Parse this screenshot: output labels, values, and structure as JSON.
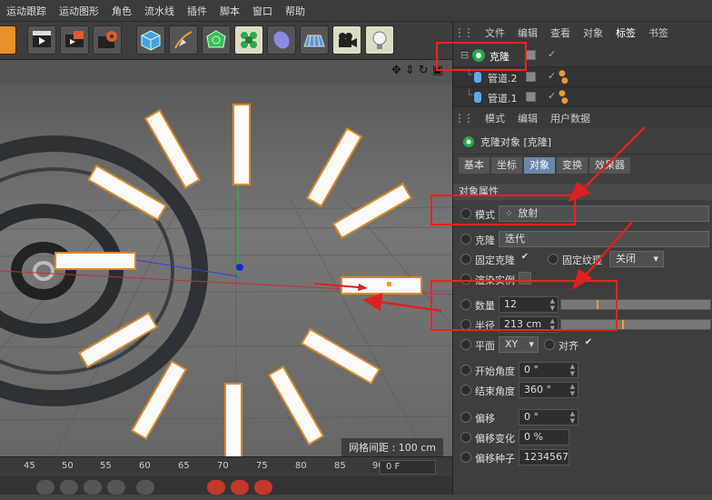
{
  "menubar": {
    "items": [
      "运动跟踪",
      "运动图形",
      "角色",
      "流水线",
      "插件",
      "脚本",
      "窗口",
      "帮助"
    ]
  },
  "toolbar": {
    "buttons": [
      "cube-icon",
      "pen-icon",
      "subdivision-icon",
      "cloner-icon",
      "deformer-icon",
      "floor-icon",
      "camera-icon",
      "light-icon"
    ]
  },
  "viewport": {
    "grid_spacing": "网格间距 : 100 cm"
  },
  "timeline": {
    "ticks": [
      "45",
      "50",
      "55",
      "60",
      "65",
      "70",
      "75",
      "80",
      "85",
      "90"
    ],
    "current_frame": "0 F"
  },
  "object_manager": {
    "menu": [
      "文件",
      "编辑",
      "查看",
      "对象",
      "标签",
      "书签"
    ],
    "active_menu_index": 4,
    "objects": [
      {
        "name": "克隆",
        "type": "cloner"
      },
      {
        "name": "管道.2",
        "type": "tube"
      },
      {
        "name": "管道.1",
        "type": "tube"
      }
    ]
  },
  "attribute_manager": {
    "menu": [
      "模式",
      "编辑",
      "用户数据"
    ],
    "title": "克隆对象 [克隆]",
    "tabs": [
      "基本",
      "坐标",
      "对象",
      "变换",
      "效果器"
    ],
    "active_tab_index": 2,
    "section_title": "对象属性",
    "mode": {
      "label": "模式",
      "value": "放射"
    },
    "clone": {
      "label": "克隆",
      "value": "迭代"
    },
    "fix_clone": {
      "label": "固定克隆",
      "checked": true
    },
    "fix_texture": {
      "label": "固定纹理",
      "value": "关闭"
    },
    "render_instance": {
      "label": "渲染实例",
      "checked": false
    },
    "count": {
      "label": "数量",
      "value": "12",
      "level": 0.24
    },
    "radius": {
      "label": "半径",
      "value": "213 cm",
      "level": 0.41
    },
    "plane": {
      "label": "平面",
      "value": "XY"
    },
    "align": {
      "label": "对齐",
      "checked": true
    },
    "start_angle": {
      "label": "开始角度",
      "value": "0 °"
    },
    "end_angle": {
      "label": "结束角度",
      "value": "360 °"
    },
    "offset": {
      "label": "偏移",
      "value": "0 °"
    },
    "offset_variation": {
      "label": "偏移变化",
      "value": "0 %"
    },
    "offset_seed": {
      "label": "偏移种子",
      "value": "1234567"
    }
  },
  "annotation_color": "#e02020"
}
